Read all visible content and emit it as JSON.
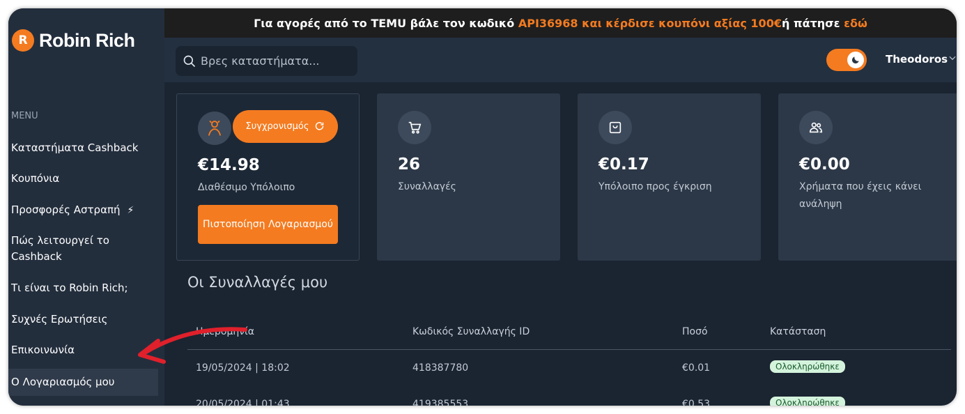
{
  "brand": {
    "logo_letter": "R",
    "name": "Robin Rich",
    "accent_color": "#f47b20"
  },
  "banner": {
    "pre": "Για αγορές από το TEMU βάλε τον κωδικό ",
    "code_offer": "API36968 και κέρδισε κουπόνι αξίας 100€",
    "mid": " ή πάτησε ",
    "link": "εδώ"
  },
  "sidebar": {
    "menu_title": "MENU",
    "items": [
      {
        "label": "Καταστήματα Cashback"
      },
      {
        "label": "Κουπόνια"
      },
      {
        "label": "Προσφορές Αστραπή",
        "icon": "lightning-icon"
      },
      {
        "label": "Πώς λειτουργεί το Cashback"
      },
      {
        "label": "Τι είναι το Robin Rich;"
      },
      {
        "label": "Συχνές Ερωτήσεις"
      },
      {
        "label": "Επικοινωνία"
      },
      {
        "label": "Ο Λογαριασμός μου",
        "active": true
      }
    ]
  },
  "header": {
    "search_placeholder": "Βρες καταστήματα...",
    "dark_mode": true,
    "user_name": "Theodoros"
  },
  "cards": {
    "balance": {
      "sync_label": "Συγχρονισμός",
      "value": "€14.98",
      "label": "Διαθέσιμο Υπόλοιπο",
      "verify_label": "Πιστοποίηση Λογαριασμού"
    },
    "transactions": {
      "value": "26",
      "label": "Συναλλαγές",
      "icon": "cart-icon"
    },
    "pending": {
      "value": "€0.17",
      "label": "Υπόλοιπο προς έγκριση",
      "icon": "bag-icon"
    },
    "withdrawn": {
      "value": "€0.00",
      "label": "Χρήματα που έχεις κάνει ανάληψη",
      "icon": "users-icon"
    }
  },
  "transactions": {
    "title": "Οι Συναλλαγές μου",
    "columns": [
      "Ημερομηνία",
      "Κωδικός Συναλλαγής ID",
      "Ποσό",
      "Κατάσταση"
    ],
    "rows": [
      {
        "date": "19/05/2024 | 18:02",
        "id": "418387780",
        "amount": "€0.01",
        "status": "Ολοκληρώθηκε"
      },
      {
        "date": "20/05/2024 | 01:43",
        "id": "419385553",
        "amount": "€0.53",
        "status": "Ολοκληρώθηκε"
      }
    ]
  }
}
